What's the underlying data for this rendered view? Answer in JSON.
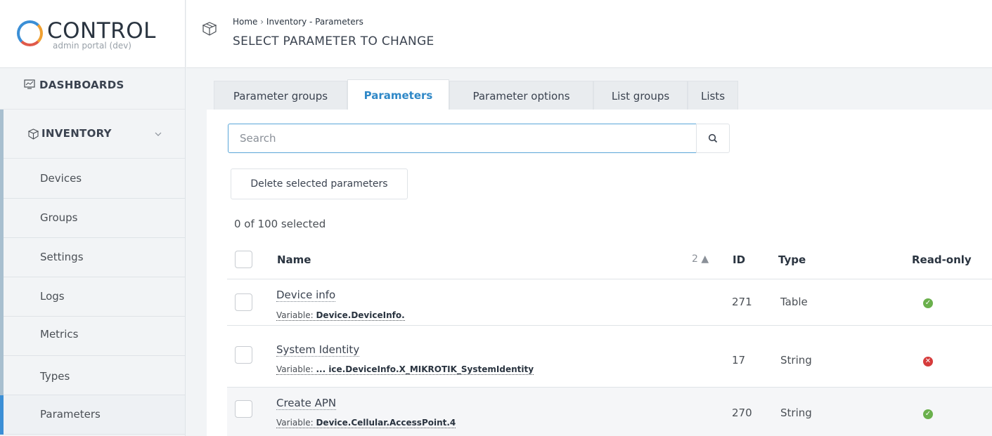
{
  "app": {
    "title": "CONTROL",
    "subtitle": "admin portal (dev)"
  },
  "sidebar": {
    "dashboards_label": "DASHBOARDS",
    "inventory_label": "INVENTORY",
    "items": [
      {
        "label": "Devices"
      },
      {
        "label": "Groups"
      },
      {
        "label": "Settings"
      },
      {
        "label": "Logs"
      },
      {
        "label": "Metrics"
      },
      {
        "label": "Types"
      },
      {
        "label": "Parameters"
      }
    ]
  },
  "header": {
    "breadcrumb_home": "Home",
    "breadcrumb_sep": "›",
    "breadcrumb_rest": "Inventory - Parameters",
    "title": "SELECT PARAMETER TO CHANGE"
  },
  "tabs": [
    {
      "label": "Parameter groups"
    },
    {
      "label": "Parameters"
    },
    {
      "label": "Parameter options"
    },
    {
      "label": "List groups"
    },
    {
      "label": "Lists"
    }
  ],
  "search": {
    "placeholder": "Search"
  },
  "actions": {
    "delete_label": "Delete selected parameters"
  },
  "selection": {
    "count_text": "0 of 100 selected"
  },
  "table": {
    "columns": {
      "name": "Name",
      "sort_indicator": "2 ▲",
      "id": "ID",
      "type": "Type",
      "readonly": "Read-only"
    },
    "rows": [
      {
        "name": "Device info",
        "var_label": "Variable:",
        "variable": "Device.DeviceInfo.",
        "id": "271",
        "type": "Table",
        "readonly": true
      },
      {
        "name": "System Identity",
        "var_label": "Variable:",
        "variable": "... ice.DeviceInfo.X_MIKROTIK_SystemIdentity",
        "id": "17",
        "type": "String",
        "readonly": false
      },
      {
        "name": "Create APN",
        "var_label": "Variable:",
        "variable": "Device.Cellular.AccessPoint.4",
        "id": "270",
        "type": "String",
        "readonly": true
      }
    ]
  },
  "colors": {
    "accent": "#2f88c7",
    "ok": "#6ab04c",
    "error": "#d63b3b"
  }
}
